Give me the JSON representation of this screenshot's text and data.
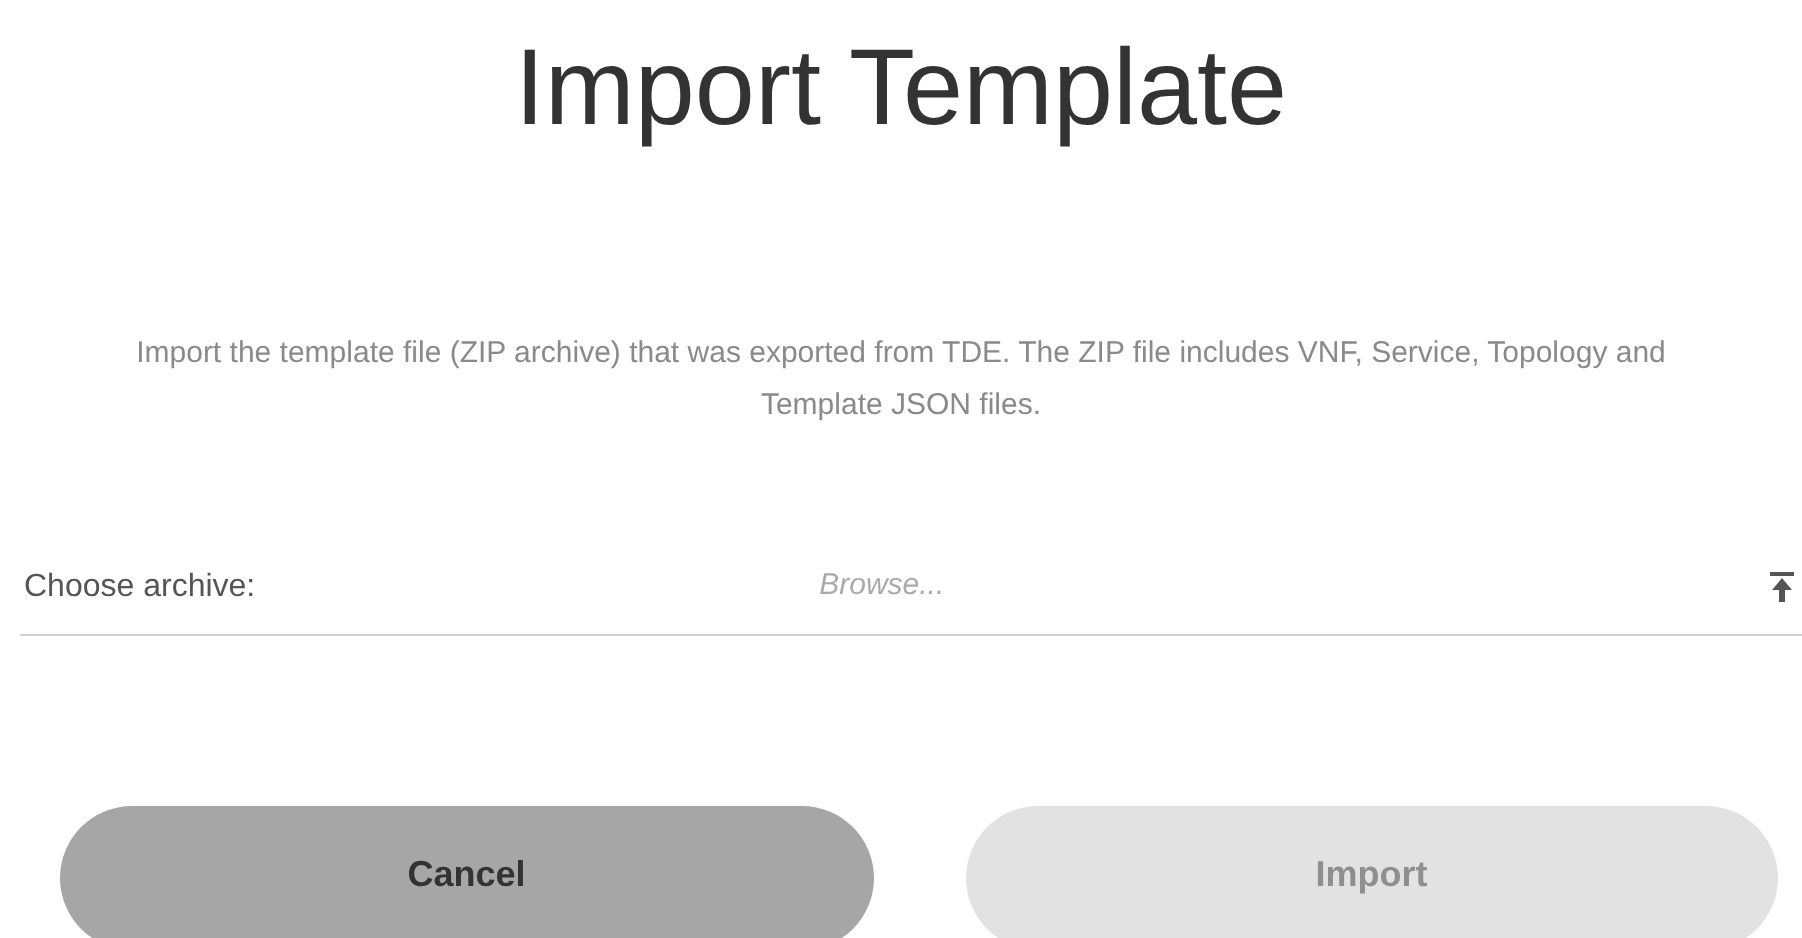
{
  "dialog": {
    "title": "Import Template",
    "description": "Import the template file (ZIP archive) that was exported from TDE. The ZIP file includes VNF, Service, Topology and Template JSON files.",
    "field": {
      "label": "Choose archive:",
      "placeholder": "Browse..."
    },
    "buttons": [
      {
        "label": "Cancel",
        "kind": "secondary",
        "disabled": false
      },
      {
        "label": "Import",
        "kind": "primary",
        "disabled": true
      }
    ]
  }
}
